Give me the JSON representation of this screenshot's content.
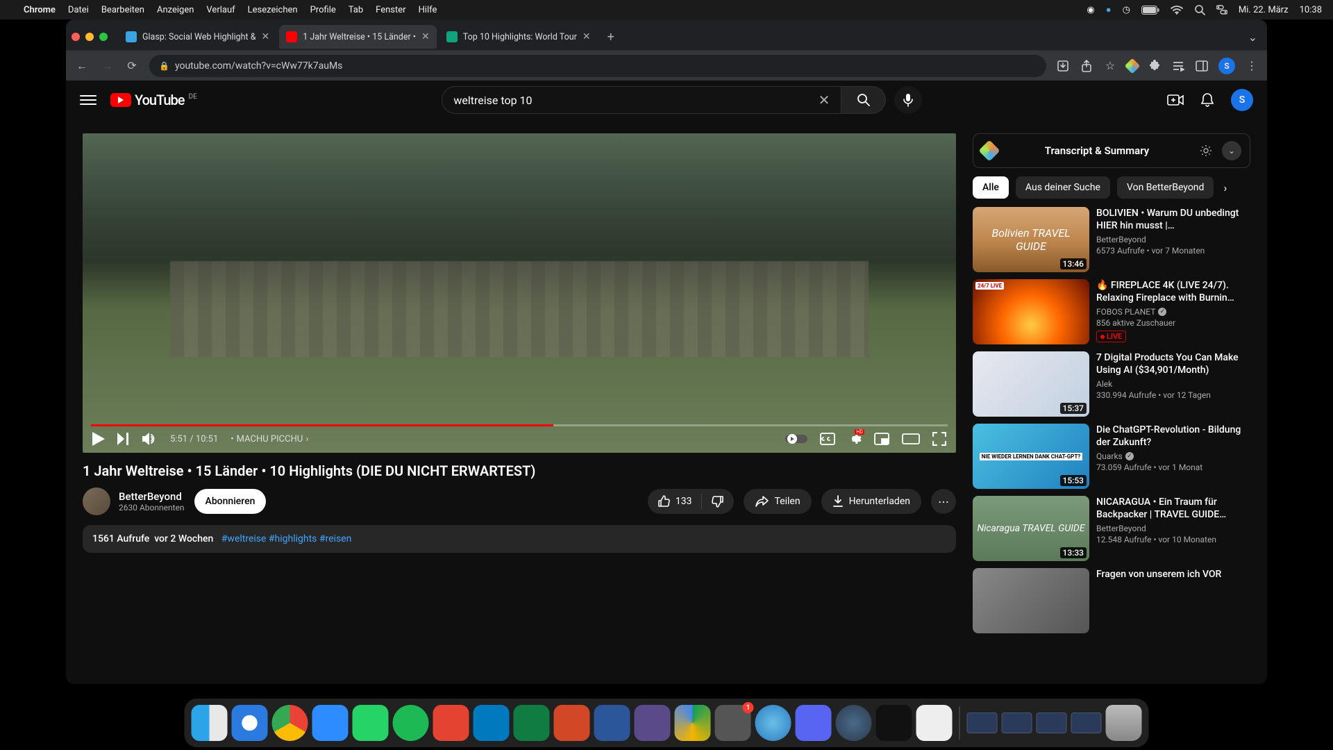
{
  "menubar": {
    "app": "Chrome",
    "items": [
      "Datei",
      "Bearbeiten",
      "Anzeigen",
      "Verlauf",
      "Lesezeichen",
      "Profile",
      "Tab",
      "Fenster",
      "Hilfe"
    ],
    "date": "Mi. 22. März",
    "time": "10:38"
  },
  "browser": {
    "tabs": [
      {
        "title": "Glasp: Social Web Highlight &",
        "favicon": "#3aa3e3"
      },
      {
        "title": "1 Jahr Weltreise • 15 Länder •",
        "favicon": "#ff0000"
      },
      {
        "title": "Top 10 Highlights: World Tour",
        "favicon": "#10a37f"
      }
    ],
    "url": "youtube.com/watch?v=cWw77k7auMs",
    "avatar": "S"
  },
  "yt": {
    "region": "DE",
    "logo_text": "YouTube",
    "search_value": "weltreise top 10",
    "avatar": "S",
    "player": {
      "current": "5:51",
      "total": "10:51",
      "chapter": "MACHU PICCHU",
      "hd": "HD"
    },
    "video": {
      "title": "1 Jahr Weltreise • 15 Länder • 10 Highlights (DIE DU NICHT ERWARTEST)",
      "channel": "BetterBeyond",
      "subs": "2630 Abonnenten",
      "subscribe": "Abonnieren",
      "likes": "133",
      "share": "Teilen",
      "download": "Herunterladen",
      "desc_views": "1561 Aufrufe",
      "desc_date": "vor 2 Wochen",
      "desc_tags": "#weltreise #highlights #reisen"
    },
    "ts_panel": "Transcript & Summary",
    "chips": [
      "Alle",
      "Aus deiner Suche",
      "Von BetterBeyond"
    ],
    "recs": [
      {
        "title": "BOLIVIEN • Warum DU unbedingt HIER hin musst |…",
        "chan": "BetterBeyond",
        "stats": "6573 Aufrufe • vor 7 Monaten",
        "dur": "13:46",
        "thumb_label": "Bolivien TRAVEL GUIDE"
      },
      {
        "title": "🔥 FIREPLACE 4K (LIVE 24/7). Relaxing Fireplace with Burnin…",
        "chan": "FOBOS PLANET",
        "verified": true,
        "stats": "856 aktive Zuschauer",
        "live": true,
        "live_label": "LIVE",
        "thumb_live": "24/7 LIVE"
      },
      {
        "title": "7 Digital Products You Can Make Using AI ($34,901/Month)",
        "chan": "Alek",
        "stats": "330.994 Aufrufe • vor 12 Tagen",
        "dur": "15:37"
      },
      {
        "title": "Die ChatGPT-Revolution - Bildung der Zukunft?",
        "chan": "Quarks",
        "verified": true,
        "stats": "73.059 Aufrufe • vor 1 Monat",
        "dur": "15:53",
        "thumb_label": "NIE WIEDER LERNEN DANK CHAT-GPT?"
      },
      {
        "title": "NICARAGUA • Ein Traum für Backpacker | TRAVEL GUIDE…",
        "chan": "BetterBeyond",
        "stats": "12.548 Aufrufe • vor 10 Monaten",
        "dur": "13:33",
        "thumb_label": "Nicaragua TRAVEL GUIDE"
      },
      {
        "title": "Fragen von unserem ich VOR",
        "chan": "",
        "stats": ""
      }
    ]
  }
}
